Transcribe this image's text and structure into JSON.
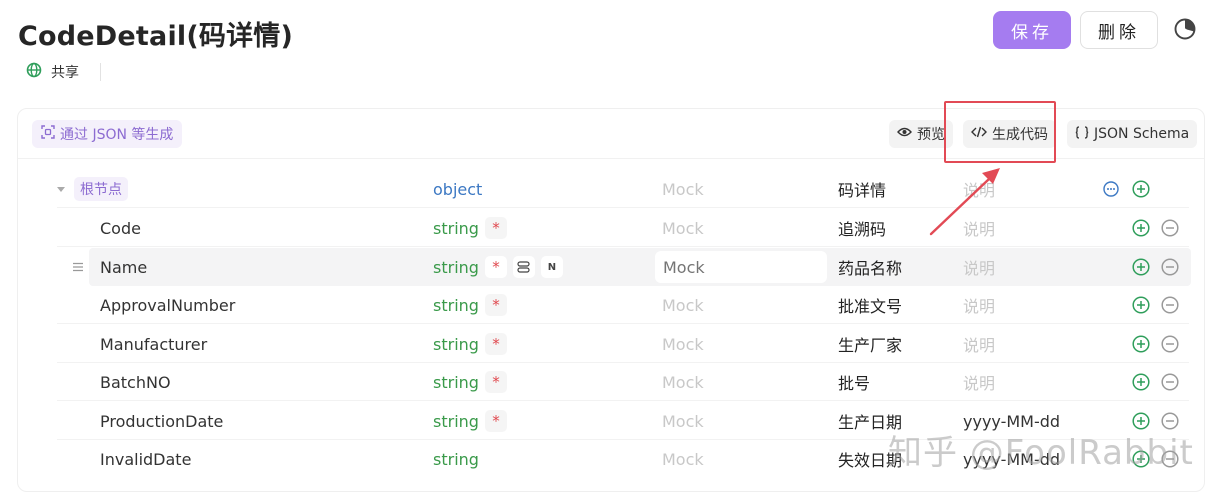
{
  "page": {
    "title": "CodeDetail(码详情)",
    "share_label": "共享",
    "save_label": "保存",
    "delete_label": "删除"
  },
  "toolbar": {
    "generate_json_label": "通过 JSON 等生成",
    "preview_label": "预览",
    "generate_code_label": "生成代码",
    "json_schema_label": "JSON Schema"
  },
  "colors": {
    "accent": "#a57cf0",
    "string_type": "#3a9a4a",
    "object_type": "#3c78c3",
    "required": "#e0484e",
    "annotation": "#e24a55"
  },
  "rows": [
    {
      "name": "根节点",
      "type": "object",
      "required": false,
      "mock": "Mock",
      "title": "码详情",
      "description": "说明",
      "is_root": true
    },
    {
      "name": "Code",
      "type": "string",
      "required": true,
      "mock": "Mock",
      "title": "追溯码",
      "description": "说明"
    },
    {
      "name": "Name",
      "type": "string",
      "required": true,
      "mock": "Mock",
      "title": "药品名称",
      "description": "说明",
      "hovered": true,
      "extra_badge": "N"
    },
    {
      "name": "ApprovalNumber",
      "type": "string",
      "required": true,
      "mock": "Mock",
      "title": "批准文号",
      "description": "说明"
    },
    {
      "name": "Manufacturer",
      "type": "string",
      "required": true,
      "mock": "Mock",
      "title": "生产厂家",
      "description": "说明"
    },
    {
      "name": "BatchNO",
      "type": "string",
      "required": true,
      "mock": "Mock",
      "title": "批号",
      "description": "说明"
    },
    {
      "name": "ProductionDate",
      "type": "string",
      "required": true,
      "mock": "Mock",
      "title": "生产日期",
      "description": "yyyy-MM-dd"
    },
    {
      "name": "InvalidDate",
      "type": "string",
      "required": false,
      "mock": "Mock",
      "title": "失效日期",
      "description": "yyyy-MM-dd"
    }
  ],
  "required_mark": "*",
  "watermark": "知乎 @FoolRabbit"
}
